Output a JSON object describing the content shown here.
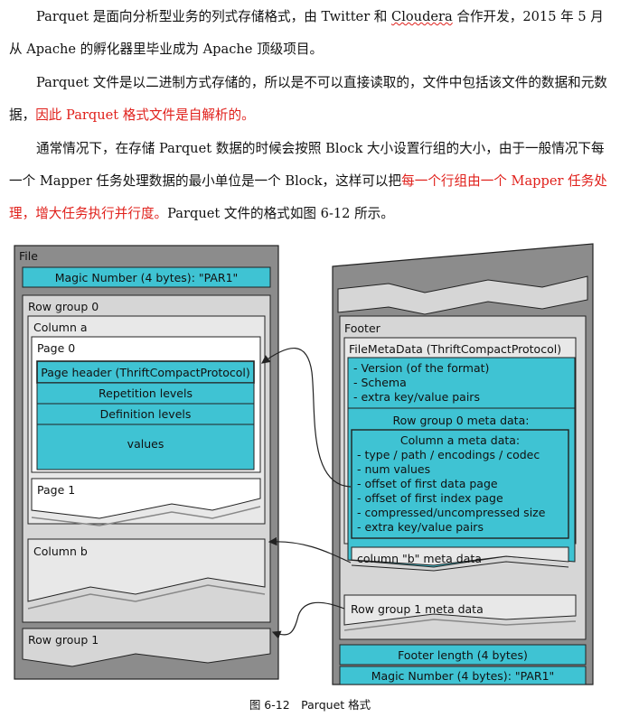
{
  "text": {
    "p1": {
      "a": "Parquet 是面向分析型业务的列式存储格式，由 Twitter 和 ",
      "underlined": "Cloudera",
      "b": " 合作开发，2015 年 5 月从 Apache 的孵化器里毕业成为 Apache 顶级项目。"
    },
    "p2": {
      "a": "Parquet 文件是以二进制方式存储的，所以是不可以直接读取的，文件中包括该文件的数据和元数据，",
      "red": "因此 Parquet 格式文件是自解析的。"
    },
    "p3": {
      "a": "通常情况下，在存储 Parquet 数据的时候会按照 Block 大小设置行组的大小，由于一般情况下每一个 Mapper 任务处理数据的最小单位是一个 Block，这样可以把",
      "red": "每一个行组由一个 Mapper 任务处理，增大任务执行并行度。",
      "b": "Parquet 文件的格式如图 6-12 所示。"
    }
  },
  "figure": {
    "file_label": "File",
    "magic_top": "Magic Number (4 bytes): \"PAR1\"",
    "row_group_0": "Row group 0",
    "column_a": "Column a",
    "page_0": "Page 0",
    "page_header": "Page header (ThriftCompactProtocol)",
    "repetition": "Repetition levels",
    "definition": "Definition levels",
    "values": "values",
    "page_1": "Page 1",
    "column_b": "Column b",
    "row_group_1": "Row group 1",
    "footer": "Footer",
    "file_meta": "FileMetaData (ThriftCompactProtocol)",
    "meta_lines": [
      "- Version (of the format)",
      "- Schema",
      "- extra key/value pairs"
    ],
    "rg0_meta": "Row group 0 meta data:",
    "col_a_meta": "Column a meta data:",
    "col_a_lines": [
      "- type / path / encodings / codec",
      "- num values",
      "- offset of first data page",
      "- offset of first index page",
      "- compressed/uncompressed size",
      "- extra key/value pairs"
    ],
    "col_b_meta": "column \"b\" meta data",
    "rg1_meta": "Row group 1 meta data",
    "footer_len": "Footer length (4 bytes)",
    "magic_bottom": "Magic Number (4 bytes): \"PAR1\""
  },
  "caption": "图 6-12　Parquet 格式",
  "colors": {
    "cyan": "#3fc3d3",
    "dark_gray": "#8c8c8c",
    "light_gray": "#d6d6d6",
    "red_text": "#e0201b"
  }
}
